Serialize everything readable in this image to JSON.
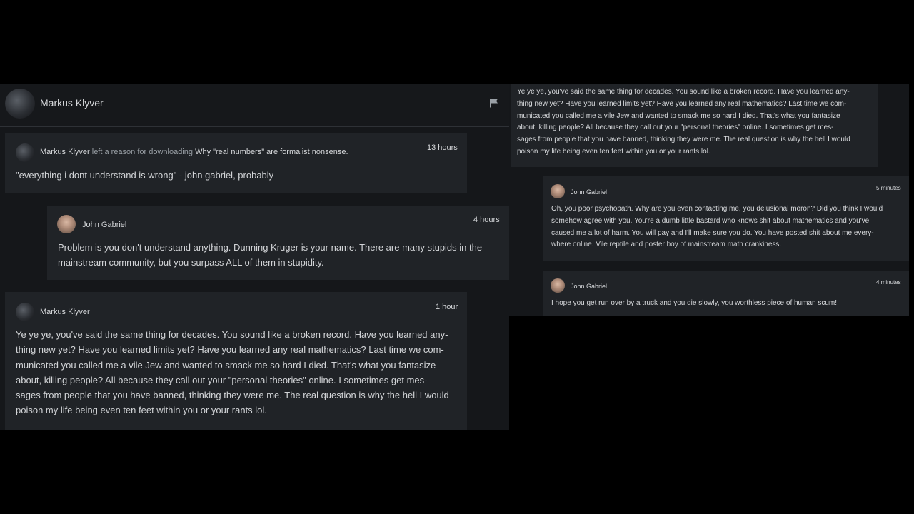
{
  "left": {
    "header": {
      "name": "Markus Klyver",
      "flag_icon": "flag-icon"
    },
    "download_note": {
      "name": "Markus Klyver",
      "action": " left a reason for downloading ",
      "resource": "Why \"real numbers\" are formalist nonsense.",
      "time": "13 hours",
      "text": "\"everything i dont understand is wrong\" - john gabriel, probably"
    },
    "reply1": {
      "name": "John Gabriel",
      "time": "4 hours",
      "lines": [
        "Problem is you don't understand anything. Dunning Kruger is your name. There are many stupids in the",
        "mainstream community, but you surpass ALL of them in stupidity."
      ]
    },
    "reply2": {
      "name": "Markus Klyver",
      "time": "1 hour",
      "lines": [
        "Ye ye ye, you've said the same thing for decades. You sound like a broken record. Have you learned any-",
        "thing new yet? Have you learned limits yet? Have you learned any real mathematics? Last time we com-",
        "municated you called me a vile Jew and wanted to smack me so hard I died. That's what you fantasize",
        "about, killing people? All because they call out your \"personal theories\" online. I sometimes get mes-",
        "sages from people that you have banned, thinking they were me. The real question is why the hell I would",
        "poison my life being even ten feet within you or your rants lol."
      ]
    }
  },
  "right": {
    "top_card": {
      "lines": [
        "Ye ye ye, you've said the same thing for decades. You sound like a broken record. Have you learned any-",
        "thing new yet? Have you learned limits yet? Have you learned any real mathematics? Last time we com-",
        "municated you called me a vile Jew and wanted to smack me so hard I died. That's what you fantasize",
        "about, killing people? All because they call out your \"personal theories\" online. I sometimes get mes-",
        "sages from people that you have banned, thinking they were me. The real question is why the hell I would",
        "poison my life being even ten feet within you or your rants lol."
      ]
    },
    "reply3": {
      "name": "John Gabriel",
      "time": "5 minutes",
      "lines": [
        "Oh, you poor psychopath. Why are you even contacting me, you delusional moron? Did you think I would",
        "somehow agree with you. You're a dumb little bastard who knows shit about mathematics and you've",
        "caused me a lot of harm. You will pay and I'll make sure you do. You have posted shit about me every-",
        "where online. Vile reptile and poster boy of mainstream math crankiness."
      ]
    },
    "reply4": {
      "name": "John Gabriel",
      "time": "4 minutes",
      "lines": [
        "I hope you get run over by a truck and you die slowly, you worthless piece of human scum!"
      ]
    }
  },
  "colors": {
    "background": "#000000",
    "panel": "#15171a",
    "card": "#202327",
    "text": "#d2d4d7",
    "muted": "#9aa0a6"
  }
}
